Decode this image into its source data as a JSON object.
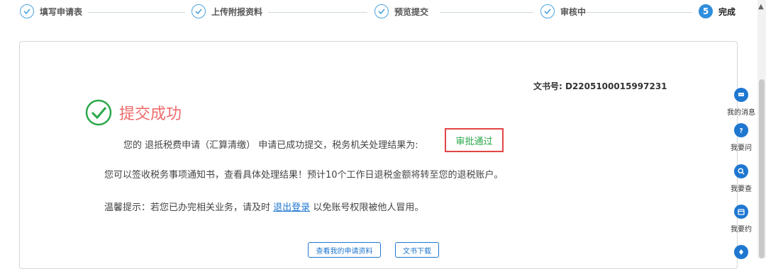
{
  "steps": [
    {
      "label": "填写申请表",
      "status": "done"
    },
    {
      "label": "上传附报资料",
      "status": "done"
    },
    {
      "label": "预览提交",
      "status": "done"
    },
    {
      "label": "审核中",
      "status": "done"
    },
    {
      "label": "完成",
      "status": "active",
      "number": "5"
    }
  ],
  "doc": {
    "label": "文书号: D2205100015997231"
  },
  "success": {
    "title": "提交成功"
  },
  "messages": {
    "line1": "您的 退抵税费申请（汇算清缴） 申请已成功提交，税务机关处理结果为:",
    "result": "审批通过",
    "line2": "您可以签收税务事项通知书，查看具体处理结果！预计10个工作日退税金额将转至您的退税账户。",
    "line3_prefix": "温馨提示：若您已办完相关业务，请及时",
    "logout_link": "退出登录",
    "line3_suffix": "以免账号权限被他人冒用。"
  },
  "buttons": {
    "view_application": "查看我的申请资料",
    "download_doc": "文书下载"
  },
  "tools": [
    {
      "label": "我的消息",
      "icon": "message-icon"
    },
    {
      "label": "我要问",
      "icon": "question-icon"
    },
    {
      "label": "我要查",
      "icon": "search-icon"
    },
    {
      "label": "我要约",
      "icon": "calendar-icon"
    }
  ],
  "colors": {
    "primary": "#1f77d0",
    "success_green": "#2aa84a",
    "title_red": "#f06b6b",
    "highlight_border": "#e24545"
  }
}
